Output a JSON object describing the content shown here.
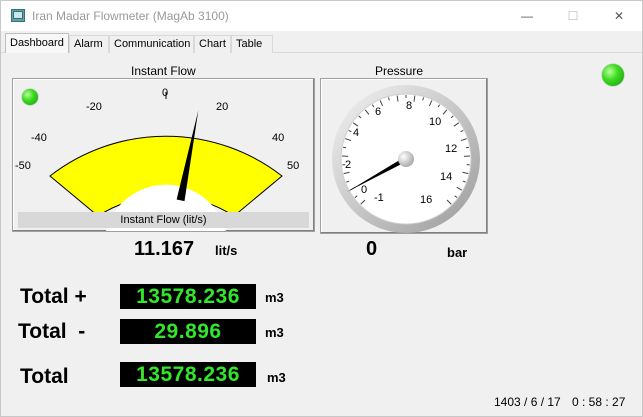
{
  "window": {
    "title": "Iran Madar Flowmeter (MagAb 3100)",
    "minimize_glyph": "—",
    "maximize_glyph": "☐",
    "close_glyph": "✕"
  },
  "tabs": [
    {
      "label": "Dashboard",
      "active": true
    },
    {
      "label": "Alarm",
      "active": false
    },
    {
      "label": "Communication",
      "active": false
    },
    {
      "label": "Chart",
      "active": false
    },
    {
      "label": "Table",
      "active": false
    }
  ],
  "instant_flow": {
    "title": "Instant Flow",
    "gauge_caption": "Instant Flow (lit/s)",
    "scale_min": -50,
    "scale_max": 50,
    "tick_labels": [
      "-50",
      "-40",
      "-20",
      "0",
      "20",
      "40",
      "50"
    ],
    "needle_value": 11.167,
    "value": "11.167",
    "unit": "lit/s",
    "fill_color": "#ffff00"
  },
  "pressure": {
    "title": "Pressure",
    "tick_labels": [
      "-1",
      "0",
      "2",
      "4",
      "6",
      "8",
      "10",
      "12",
      "14",
      "16"
    ],
    "needle_value": 0,
    "value": "0",
    "unit": "bar"
  },
  "totals": [
    {
      "label": "Total +",
      "value": "13578.236",
      "unit": "m3"
    },
    {
      "label": "Total  -",
      "value": "29.896",
      "unit": "m3"
    },
    {
      "label": "Total",
      "value": "13578.236",
      "unit": "m3"
    }
  ],
  "status_led_color": "#33dd22",
  "footer": {
    "date": "1403 / 6 / 17",
    "time": "0 : 58 : 27"
  }
}
